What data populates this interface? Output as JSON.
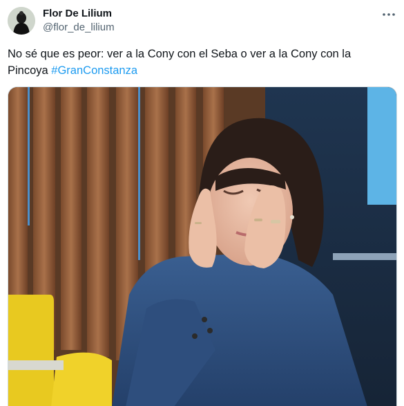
{
  "tweet": {
    "display_name": "Flor De Lilium",
    "handle": "@flor_de_lilium",
    "text_main": "No sé que es peor: ver a la Cony con el Seba o ver a la Cony con la Pincoya ",
    "hashtag": "#GranConstanza",
    "more_icon": "more-horizontal-icon",
    "avatar_icon": "profile-avatar"
  },
  "colors": {
    "text": "#0f1419",
    "secondary": "#536471",
    "link": "#1d9bf0",
    "border": "#cfd9de"
  }
}
